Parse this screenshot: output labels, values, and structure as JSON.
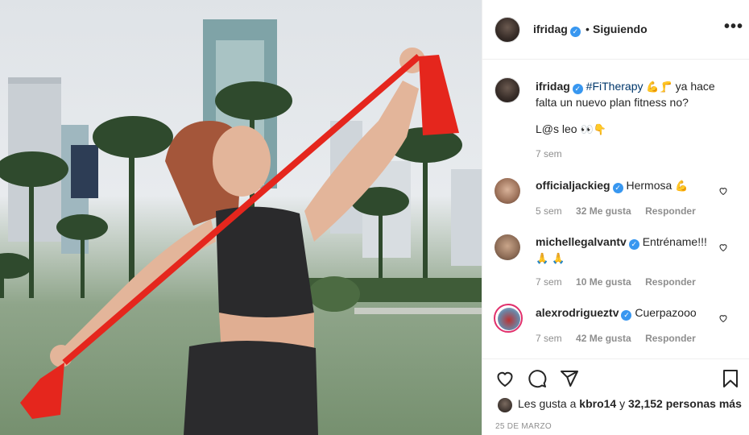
{
  "post": {
    "username": "ifridag",
    "follow_status": "Siguiendo",
    "more_label": "•••",
    "separator": "•"
  },
  "caption": {
    "username": "ifridag",
    "hashtag": "#FiTherapy",
    "emojis": "💪🦵",
    "text": "ya hace falta un nuevo plan fitness no?",
    "line2": "L@s leo",
    "line2_emojis": "👀👇",
    "time": "7 sem"
  },
  "comments": [
    {
      "username": "officialjackieg",
      "text": "Hermosa",
      "emoji": "💪",
      "time": "5 sem",
      "likes": "32 Me gusta",
      "reply": "Responder"
    },
    {
      "username": "michellegalvantv",
      "text": "Entréname!!!",
      "emoji": "🙏 🙏",
      "time": "7 sem",
      "likes": "10 Me gusta",
      "reply": "Responder"
    },
    {
      "username": "alexrodrigueztv",
      "text": "Cuerpazooo",
      "emoji": "",
      "time": "7 sem",
      "likes": "42 Me gusta",
      "reply": "Responder"
    }
  ],
  "likes": {
    "prefix": "Les gusta a",
    "user": "kbro14",
    "middle": "y",
    "count": "32,152 personas más"
  },
  "date": "25 DE MARZO",
  "icons": [
    "heart-icon",
    "comment-icon",
    "share-icon",
    "bookmark-icon",
    "verified-icon"
  ],
  "colors": {
    "link": "#00376b",
    "verified": "#3897f0",
    "muted": "#8e8e8e",
    "band": "#e5261d"
  }
}
